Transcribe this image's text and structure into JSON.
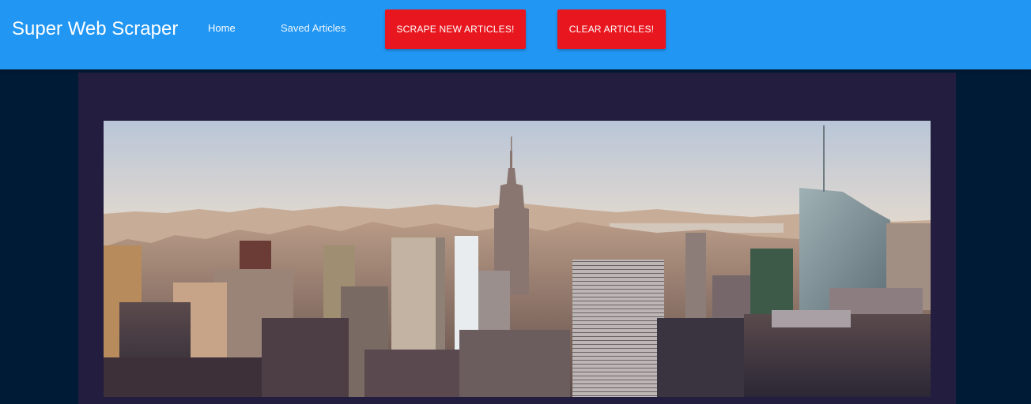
{
  "navbar": {
    "brand": "Super Web Scraper",
    "links": [
      {
        "label": "Home"
      },
      {
        "label": "Saved Articles"
      }
    ],
    "buttons": {
      "scrape_label": "SCRAPE NEW ARTICLES!",
      "clear_label": "CLEAR ARTICLES!"
    },
    "colors": {
      "navbar_bg": "#2196f3",
      "button_bg": "#e8171f",
      "page_bg": "#001b36",
      "container_bg": "#231d40"
    }
  },
  "hero": {
    "image_subject": "city-skyline-photo"
  }
}
